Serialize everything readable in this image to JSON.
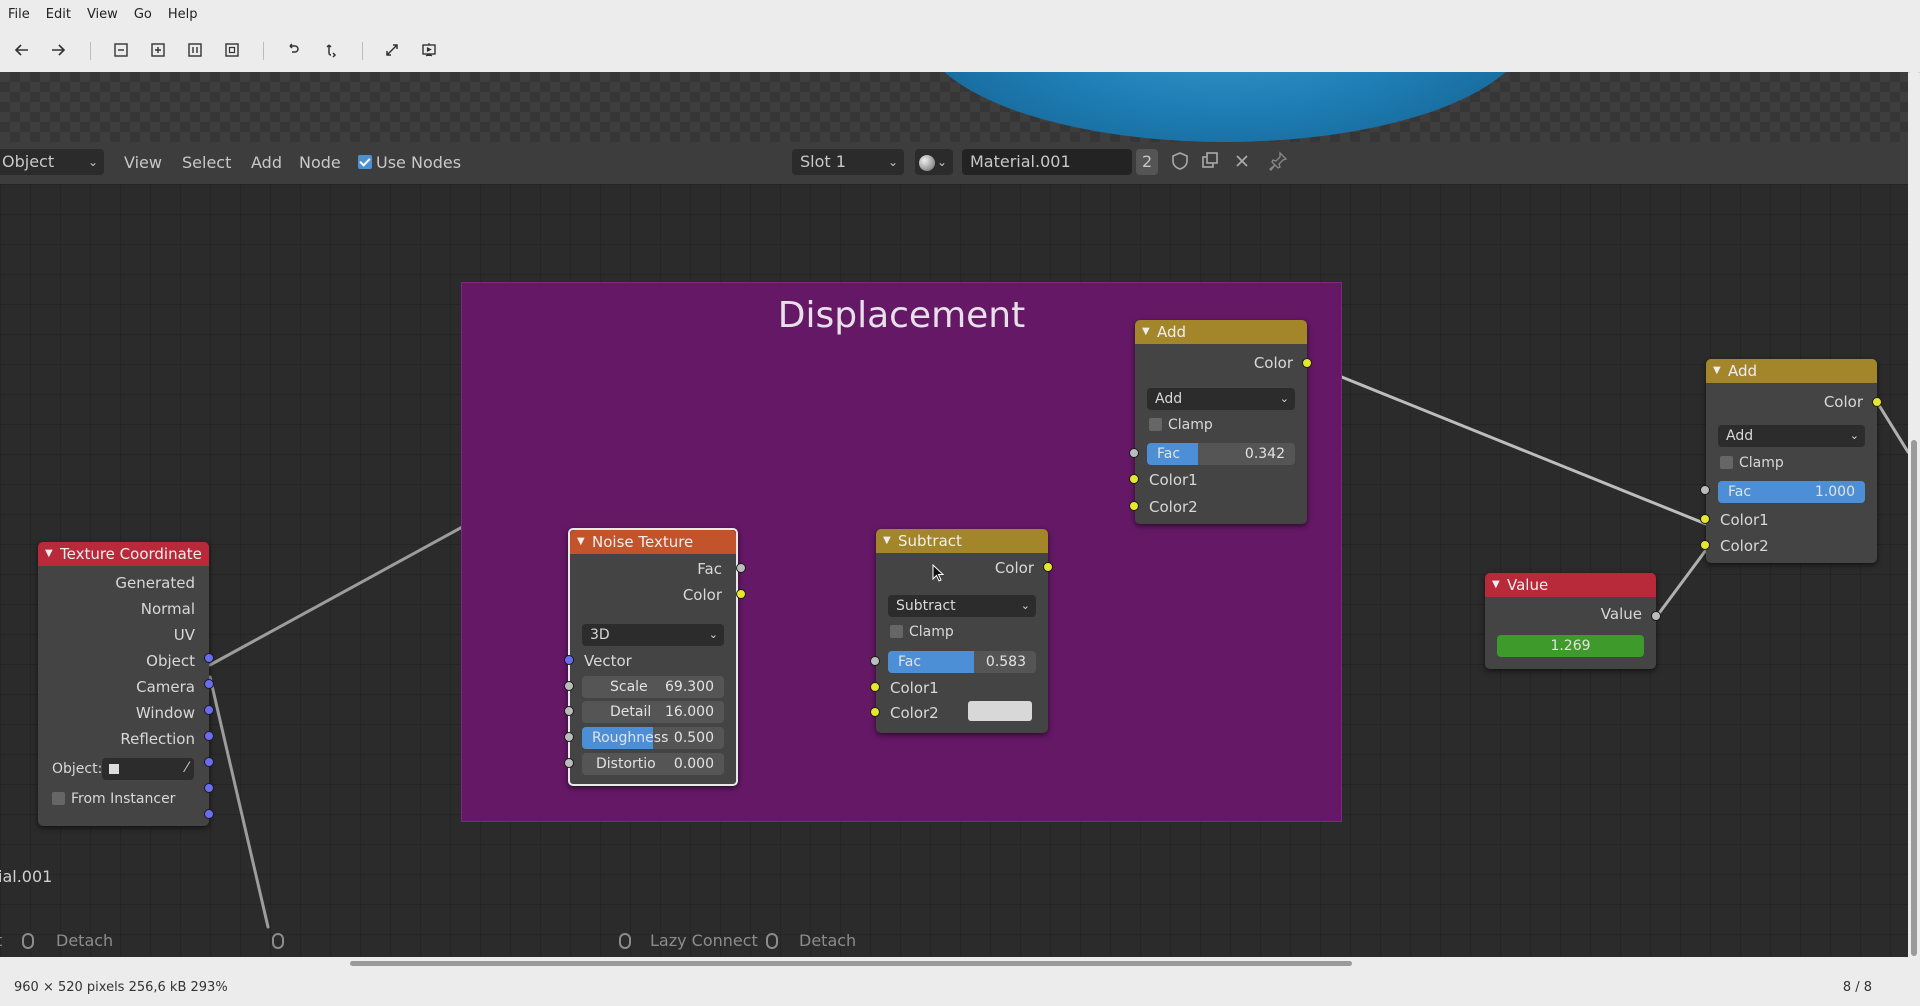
{
  "menu": [
    "File",
    "Edit",
    "View",
    "Go",
    "Help"
  ],
  "toolbar_icons": [
    "back-icon",
    "forward-icon",
    "zoom-out-icon",
    "zoom-in-icon",
    "zoom-fit-icon",
    "zoom-original-icon",
    "rotate-left-icon",
    "rotate-right-icon",
    "fullscreen-icon",
    "slideshow-icon"
  ],
  "blender_header": {
    "mode": "Object",
    "menus": [
      "View",
      "Select",
      "Add",
      "Node"
    ],
    "use_nodes": "Use Nodes",
    "slot": "Slot 1",
    "material": "Material.001",
    "users": "2"
  },
  "frame": {
    "title": "Displacement"
  },
  "texcoord": {
    "title": "Texture Coordinate",
    "outputs": [
      "Generated",
      "Normal",
      "UV",
      "Object",
      "Camera",
      "Window",
      "Reflection"
    ],
    "object_label": "Object:",
    "from_instancer": "From Instancer"
  },
  "noise": {
    "title": "Noise Texture",
    "out_fac": "Fac",
    "out_color": "Color",
    "dimensions": "3D",
    "vector": "Vector",
    "scale_label": "Scale",
    "scale": "69.300",
    "detail_label": "Detail",
    "detail": "16.000",
    "roughness_label": "Roughness",
    "roughness": "0.500",
    "roughness_frac": 0.5,
    "distortion_label": "Distortio",
    "distortion": "0.000"
  },
  "subtract": {
    "title": "Subtract",
    "out_color": "Color",
    "blend": "Subtract",
    "clamp": "Clamp",
    "fac_label": "Fac",
    "fac": "0.583",
    "fac_frac": 0.583,
    "color1": "Color1",
    "color2": "Color2"
  },
  "add1": {
    "title": "Add",
    "out_color": "Color",
    "blend": "Add",
    "clamp": "Clamp",
    "fac_label": "Fac",
    "fac": "0.342",
    "fac_frac": 0.342,
    "color1": "Color1",
    "color2": "Color2"
  },
  "add2": {
    "title": "Add",
    "out_color": "Color",
    "blend": "Add",
    "clamp": "Clamp",
    "fac_label": "Fac",
    "fac": "1.000",
    "fac_frac": 1.0,
    "color1": "Color1",
    "color2": "Color2"
  },
  "value_node": {
    "title": "Value",
    "out_value": "Value",
    "value": "1.269"
  },
  "material_label": "ial.001",
  "footer": {
    "detach_left": "Detach",
    "lazy_connect": "Lazy Connect",
    "detach_right": "Detach"
  },
  "status": {
    "info": "960 × 520 pixels  256,6 kB   293%",
    "index": "8 / 8"
  },
  "colors": {
    "frame": "#651866",
    "header_mix": "#a3852a",
    "header_texture": "#c2532a",
    "header_input": "#b8293a",
    "value_green": "#3e9a2a",
    "accent": "#4d8fd6"
  }
}
